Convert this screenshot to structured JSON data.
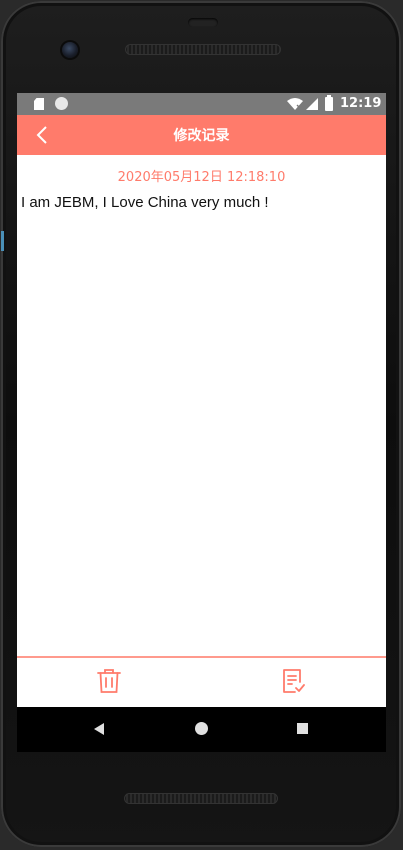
{
  "status_bar": {
    "time": "12:19",
    "icons": [
      "sd-card-icon",
      "circle-indicator-icon",
      "wifi-icon",
      "signal-icon",
      "battery-icon"
    ]
  },
  "app_bar": {
    "title": "修改记录",
    "background_color": "#ff7b6b",
    "back_icon": "chevron-left-icon"
  },
  "note": {
    "timestamp": "2020年05月12日 12:18:10",
    "content": "I am JEBM, I Love China very much !"
  },
  "bottom_actions": {
    "accent_color": "#ff7b6b",
    "delete_icon": "trash-icon",
    "save_icon": "note-check-icon"
  },
  "nav_bar": {
    "icons": [
      "nav-back-icon",
      "nav-home-icon",
      "nav-recents-icon"
    ]
  }
}
